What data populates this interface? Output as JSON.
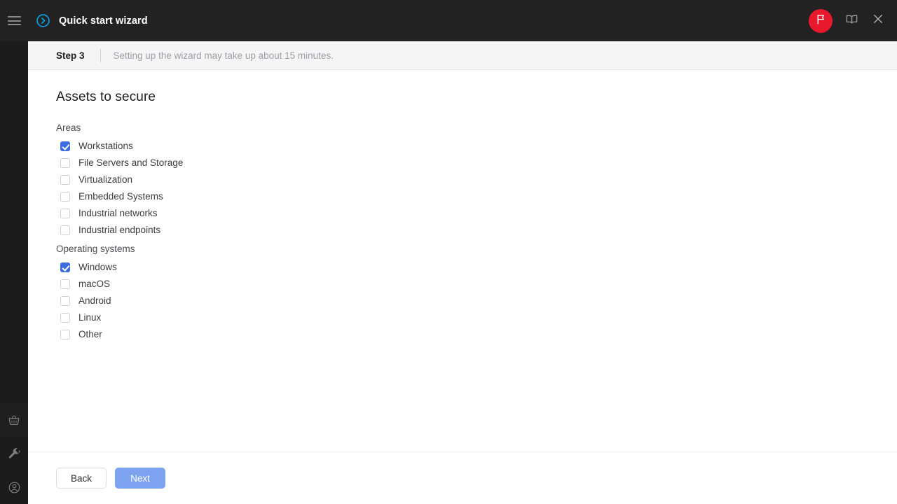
{
  "window": {
    "title": "Quick start wizard",
    "title_icon": "play-circle-icon",
    "flag_icon": "flag-icon",
    "book_icon": "book-icon",
    "close_icon": "close-icon",
    "accent_blue": "#0a9de0",
    "flag_badge_color": "#e8192c",
    "header_bg": "#222222"
  },
  "rail": {
    "menu_icon": "hamburger-menu-icon",
    "items": [
      {
        "icon": "basket-icon"
      },
      {
        "icon": "wrench-icon"
      },
      {
        "icon": "account-circle-icon"
      }
    ]
  },
  "stepbar": {
    "step": "Step 3",
    "note": "Setting up the wizard may take up about 15 minutes."
  },
  "main": {
    "heading": "Assets to secure",
    "groups": [
      {
        "label": "Areas",
        "options": [
          {
            "label": "Workstations",
            "checked": true
          },
          {
            "label": "File Servers and Storage",
            "checked": false
          },
          {
            "label": "Virtualization",
            "checked": false
          },
          {
            "label": "Embedded Systems",
            "checked": false
          },
          {
            "label": "Industrial networks",
            "checked": false
          },
          {
            "label": "Industrial endpoints",
            "checked": false
          }
        ]
      },
      {
        "label": "Operating systems",
        "options": [
          {
            "label": "Windows",
            "checked": true
          },
          {
            "label": "macOS",
            "checked": false
          },
          {
            "label": "Android",
            "checked": false
          },
          {
            "label": "Linux",
            "checked": false
          },
          {
            "label": "Other",
            "checked": false
          }
        ]
      }
    ]
  },
  "footer": {
    "back_label": "Back",
    "next_label": "Next",
    "next_disabled": true,
    "next_color": "#7da2f0"
  }
}
